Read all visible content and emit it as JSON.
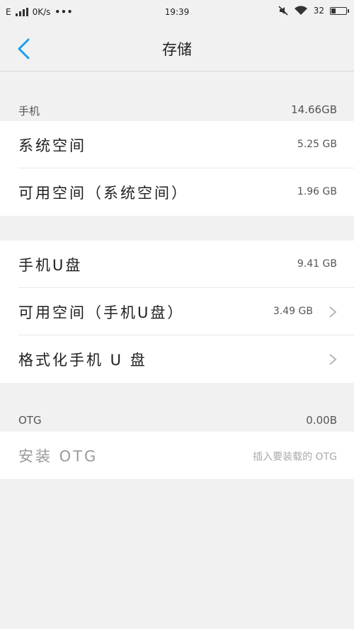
{
  "status_bar": {
    "network": "E",
    "speed": "0K/s",
    "dots": "•••",
    "time": "19:39",
    "battery": "32",
    "battery_level": 0.32
  },
  "header": {
    "title": "存储"
  },
  "phone_section": {
    "label": "手机",
    "total": "14.66GB",
    "rows": [
      {
        "label": "系统空间",
        "value": "5.25 GB"
      },
      {
        "label": "可用空间（系统空间）",
        "value": "1.96 GB"
      }
    ]
  },
  "udisk_section": {
    "rows": [
      {
        "label": "手机U盘",
        "value": "9.41 GB"
      },
      {
        "label": "可用空间（手机U盘）",
        "value": "3.49 GB"
      },
      {
        "label": "格式化手机 U 盘",
        "value": ""
      }
    ]
  },
  "otg_section": {
    "label": "OTG",
    "total": "0.00B",
    "rows": [
      {
        "label": "安装 OTG",
        "value": "插入要装载的 OTG"
      }
    ]
  },
  "colors": {
    "accent": "#1a9ee6",
    "background": "#f1f1f1",
    "card": "#ffffff"
  }
}
